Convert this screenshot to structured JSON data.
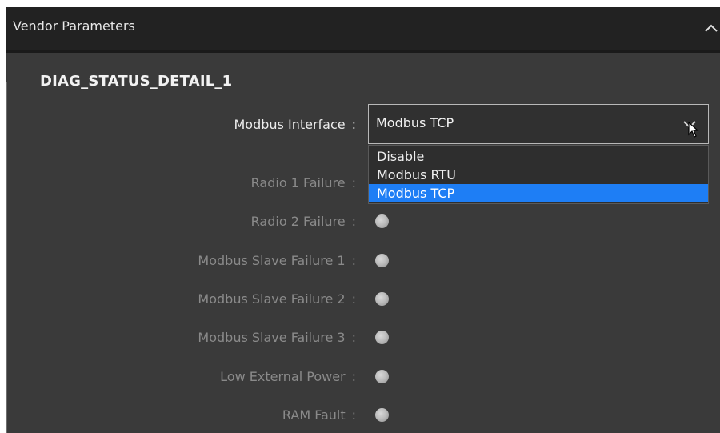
{
  "panel": {
    "title": "Vendor Parameters"
  },
  "group": {
    "title": "DIAG_STATUS_DETAIL_1"
  },
  "modbus_interface": {
    "label": "Modbus Interface",
    "colon": ":",
    "value": "Modbus TCP",
    "options": [
      "Disable",
      "Modbus RTU",
      "Modbus TCP"
    ],
    "selected_option": "Modbus TCP"
  },
  "status_fields": [
    {
      "label": "Radio 1 Failure",
      "colon": ":",
      "indicator": "grey"
    },
    {
      "label": "Radio 2 Failure",
      "colon": ":",
      "indicator": "grey"
    },
    {
      "label": "Modbus Slave Failure 1",
      "colon": ":",
      "indicator": "grey"
    },
    {
      "label": "Modbus Slave Failure 2",
      "colon": ":",
      "indicator": "grey"
    },
    {
      "label": "Modbus Slave Failure 3",
      "colon": ":",
      "indicator": "grey"
    },
    {
      "label": "Low External Power",
      "colon": ":",
      "indicator": "grey"
    },
    {
      "label": "RAM Fault",
      "colon": ":",
      "indicator": "grey"
    }
  ],
  "icons": {
    "collapse": "chevron-up-icon",
    "dropdown": "chevron-down-icon",
    "cursor": "mouse-pointer-icon"
  },
  "colors": {
    "header_bg": "#222222",
    "panel_bg": "#3a3a3a",
    "selection": "#1e7ef5",
    "indicator": "#bdbdbd"
  }
}
